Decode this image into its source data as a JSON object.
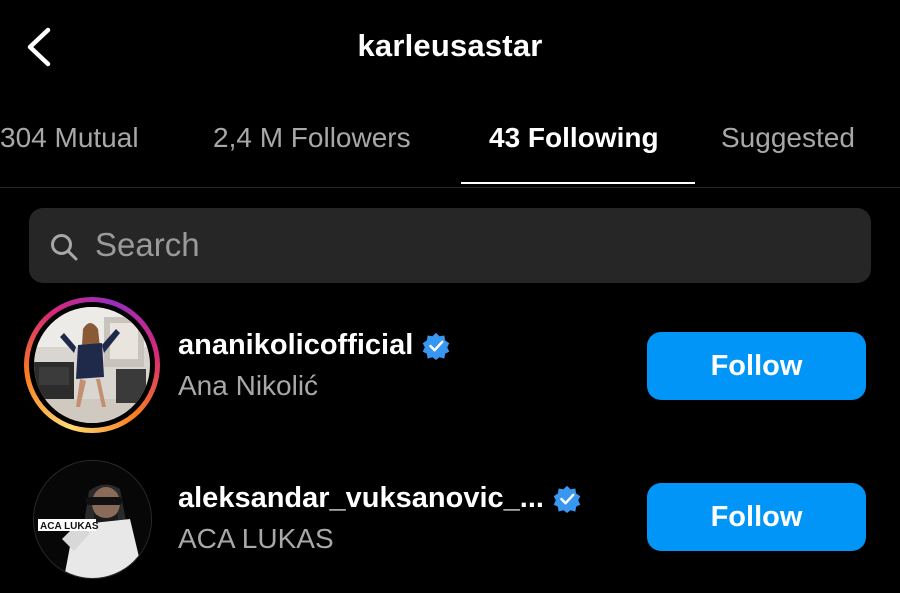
{
  "header": {
    "title": "karleusastar",
    "back_icon": "chevron-left-icon"
  },
  "tabs": [
    {
      "label": "304 Mutual",
      "active": false
    },
    {
      "label": "2,4 M Followers",
      "active": false
    },
    {
      "label": "43 Following",
      "active": true
    },
    {
      "label": "Suggested",
      "active": false
    }
  ],
  "search": {
    "placeholder": "Search",
    "icon": "search-icon"
  },
  "accounts": [
    {
      "username": "ananikolicofficial",
      "full_name": "Ana Nikolić",
      "verified": true,
      "has_story_ring": true,
      "follow_label": "Follow"
    },
    {
      "username": "aleksandar_vuksanovic_...",
      "full_name": "ACA LUKAS",
      "verified": true,
      "has_story_ring": false,
      "follow_label": "Follow",
      "avatar_logo_text": "ACA LUKAS"
    }
  ],
  "colors": {
    "background": "#000000",
    "follow_button": "#0095f6",
    "verified_badge": "#3897f0",
    "search_bg": "#262626",
    "secondary_text": "#a8a8a8"
  }
}
